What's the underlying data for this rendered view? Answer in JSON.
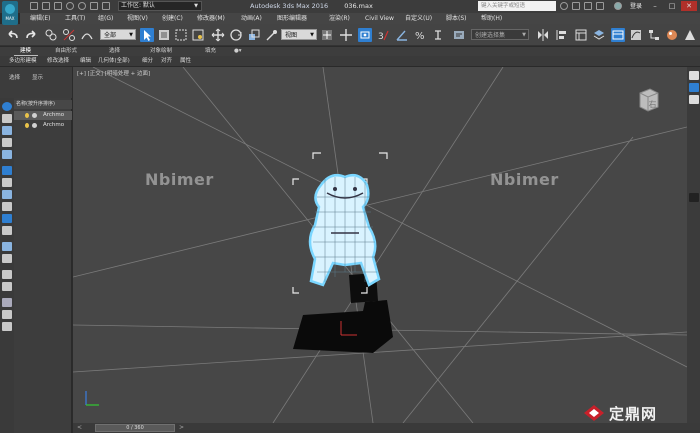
{
  "window": {
    "logo_text": "MAX",
    "workspace": "工作区: 默认",
    "title": "Autodesk 3ds Max 2016",
    "file": "036.max",
    "search_placeholder": "键入关键字或短语",
    "login": "登录"
  },
  "menu": [
    "编辑(E)",
    "工具(T)",
    "组(G)",
    "视图(V)",
    "创建(C)",
    "修改器(M)",
    "动画(A)",
    "图形编辑器",
    "渲染(R)",
    "Civil View",
    "自定义(U)",
    "脚本(S)",
    "帮助(H)"
  ],
  "toolbar": {
    "filter": "全部",
    "ref_coord": "视图",
    "selection_set": "创建选择集"
  },
  "ribbon": {
    "tabs": [
      "建模",
      "自由形式",
      "选择",
      "对象绘制",
      "填充"
    ],
    "active_tab": "建模",
    "commands": [
      "多边形建模",
      "修改选择",
      "编辑",
      "几何体(全部)",
      "细分",
      "对齐",
      "属性"
    ]
  },
  "explorer": {
    "tabs": [
      "选择",
      "显示"
    ],
    "column_header": "名称(按升序排序)",
    "rows": [
      "Archmo",
      "Archmo"
    ]
  },
  "viewport": {
    "label": "[+] [正交] [明暗处理 + 边面]",
    "watermark_left": "Nbimer",
    "watermark_right": "Nbimer",
    "viewcube_face": "右"
  },
  "timeline": {
    "frame": "0 / 360",
    "prev": "<",
    "next": ">"
  },
  "site_logo": "定鼎网",
  "colors": {
    "viewport_bg": "#474747",
    "wire_white": "#ffffff",
    "wire_glow": "#7ad6ff",
    "pedestal": "#0a0a0a",
    "close_red": "#b0302a",
    "accent_blue": "#2f7fd1"
  }
}
